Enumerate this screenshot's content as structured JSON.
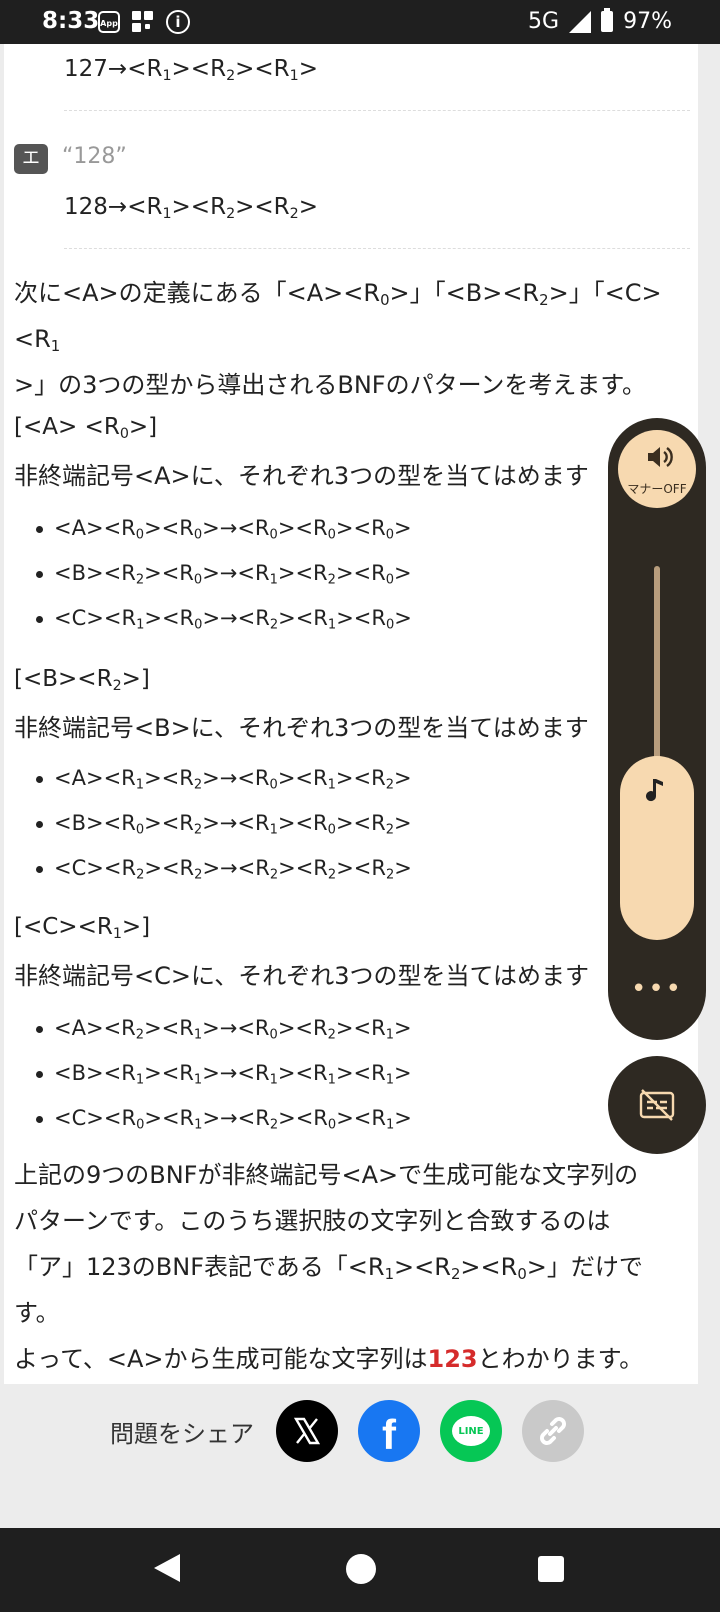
{
  "status_bar": {
    "time": "8:33",
    "app_icon_label": "App",
    "info_icon_label": "i",
    "network": "5G",
    "battery": "97%",
    "icons": [
      "app-notification-icon",
      "grid-icon",
      "info-icon",
      "signal-icon",
      "battery-icon"
    ]
  },
  "answers": {
    "row1": {
      "num": "127",
      "arrow": "→",
      "r1": "1",
      "r2": "2",
      "r3": "1"
    },
    "choice_e": {
      "badge": "エ",
      "value": "“128”"
    },
    "row2": {
      "num": "128",
      "arrow": "→",
      "r1": "1",
      "r2": "2",
      "r3": "2"
    }
  },
  "intro": {
    "text_before": "次に<A>の定義にある「<A><R",
    "sub0": "0",
    "mid1": ">」「<B><R",
    "sub2": "2",
    "mid2": ">」「<C><R",
    "sub1": "1",
    "line2": ">」の3つの型から導出されるBNFのパターンを考えます。"
  },
  "sections": [
    {
      "heading_pre": "[<A> <R",
      "heading_sub": "0",
      "heading_post": ">]",
      "description": "非終端記号<A>に、それぞれ3つの型を当てはめます",
      "items": [
        {
          "n": "A",
          "a": "0",
          "b": "0",
          "c": "0",
          "d": "0",
          "e": "0"
        },
        {
          "n": "B",
          "a": "2",
          "b": "0",
          "c": "1",
          "d": "2",
          "e": "0"
        },
        {
          "n": "C",
          "a": "1",
          "b": "0",
          "c": "2",
          "d": "1",
          "e": "0"
        }
      ]
    },
    {
      "heading_pre": "[<B><R",
      "heading_sub": "2",
      "heading_post": ">]",
      "description": "非終端記号<B>に、それぞれ3つの型を当てはめます",
      "items": [
        {
          "n": "A",
          "a": "1",
          "b": "2",
          "c": "0",
          "d": "1",
          "e": "2"
        },
        {
          "n": "B",
          "a": "0",
          "b": "2",
          "c": "1",
          "d": "0",
          "e": "2"
        },
        {
          "n": "C",
          "a": "2",
          "b": "2",
          "c": "2",
          "d": "2",
          "e": "2"
        }
      ]
    },
    {
      "heading_pre": "[<C><R",
      "heading_sub": "1",
      "heading_post": ">]",
      "description": "非終端記号<C>に、それぞれ3つの型を当てはめます",
      "items": [
        {
          "n": "A",
          "a": "2",
          "b": "1",
          "c": "0",
          "d": "2",
          "e": "1"
        },
        {
          "n": "B",
          "a": "1",
          "b": "1",
          "c": "1",
          "d": "1",
          "e": "1"
        },
        {
          "n": "C",
          "a": "0",
          "b": "1",
          "c": "2",
          "d": "0",
          "e": "1"
        }
      ]
    }
  ],
  "conclusion": {
    "line1": "上記の9つのBNFが非終端記号<A>で生成可能な文字列の",
    "line2": "パターンです。このうち選択肢の文字列と合致するのは",
    "line3_pre": "「ア」123のBNF表記である「<R",
    "line3_s1": "1",
    "line3_m1": "><R",
    "line3_s2": "2",
    "line3_m2": "><R",
    "line3_s3": "0",
    "line3_post": ">」だけです。",
    "line4_pre": "よって、<A>から生成可能な文字列は",
    "line4_answer": "123",
    "line4_post": "とわかります。"
  },
  "share": {
    "label": "問題をシェア",
    "buttons": [
      "x-icon",
      "facebook-icon",
      "line-icon",
      "link-icon"
    ],
    "line_text": "LINE",
    "fb_text": "f"
  },
  "volume_panel": {
    "mode_label": "マナーOFF",
    "more": "•••"
  },
  "colors": {
    "accent_red": "#d52b2b",
    "facebook": "#1877f2",
    "line": "#06c755",
    "volume_bg": "#2e2922",
    "volume_accent": "#f7d9b0"
  }
}
